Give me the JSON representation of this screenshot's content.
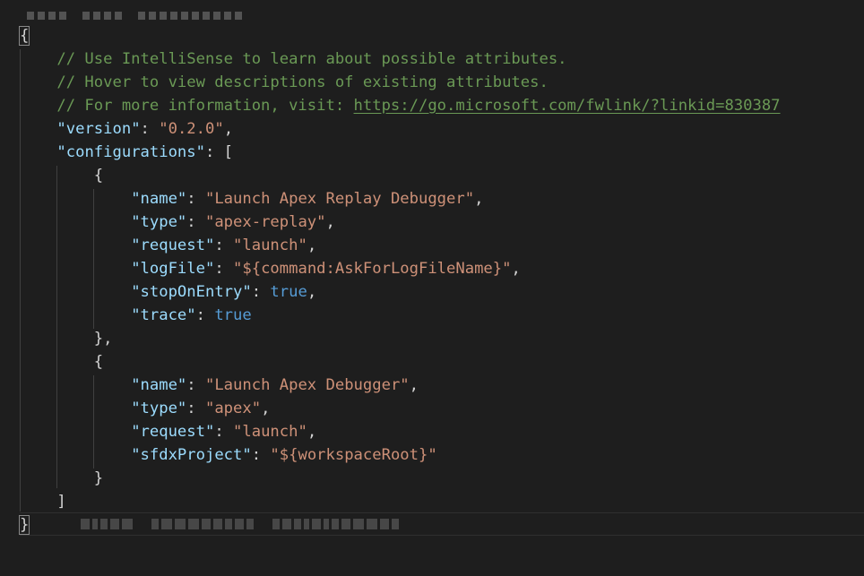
{
  "editor": {
    "lines": [
      [
        {
          "t": "{",
          "c": "punc bracket-hl"
        }
      ],
      [
        {
          "t": "    // Use IntelliSense to learn about possible attributes.",
          "c": "comment"
        }
      ],
      [
        {
          "t": "    // Hover to view descriptions of existing attributes.",
          "c": "comment"
        }
      ],
      [
        {
          "t": "    // For more information, visit: ",
          "c": "comment"
        },
        {
          "t": "https://go.microsoft.com/fwlink/?linkid=830387",
          "c": "link"
        }
      ],
      [
        {
          "t": "    ",
          "c": "punc"
        },
        {
          "t": "\"version\"",
          "c": "key"
        },
        {
          "t": ": ",
          "c": "punc"
        },
        {
          "t": "\"0.2.0\"",
          "c": "str"
        },
        {
          "t": ",",
          "c": "punc"
        }
      ],
      [
        {
          "t": "    ",
          "c": "punc"
        },
        {
          "t": "\"configurations\"",
          "c": "key"
        },
        {
          "t": ": [",
          "c": "punc"
        }
      ],
      [
        {
          "t": "        {",
          "c": "punc"
        }
      ],
      [
        {
          "t": "            ",
          "c": "punc"
        },
        {
          "t": "\"name\"",
          "c": "key"
        },
        {
          "t": ": ",
          "c": "punc"
        },
        {
          "t": "\"Launch Apex Replay Debugger\"",
          "c": "str"
        },
        {
          "t": ",",
          "c": "punc"
        }
      ],
      [
        {
          "t": "            ",
          "c": "punc"
        },
        {
          "t": "\"type\"",
          "c": "key"
        },
        {
          "t": ": ",
          "c": "punc"
        },
        {
          "t": "\"apex-replay\"",
          "c": "str"
        },
        {
          "t": ",",
          "c": "punc"
        }
      ],
      [
        {
          "t": "            ",
          "c": "punc"
        },
        {
          "t": "\"request\"",
          "c": "key"
        },
        {
          "t": ": ",
          "c": "punc"
        },
        {
          "t": "\"launch\"",
          "c": "str"
        },
        {
          "t": ",",
          "c": "punc"
        }
      ],
      [
        {
          "t": "            ",
          "c": "punc"
        },
        {
          "t": "\"logFile\"",
          "c": "key"
        },
        {
          "t": ": ",
          "c": "punc"
        },
        {
          "t": "\"${command:AskForLogFileName}\"",
          "c": "str"
        },
        {
          "t": ",",
          "c": "punc"
        }
      ],
      [
        {
          "t": "            ",
          "c": "punc"
        },
        {
          "t": "\"stopOnEntry\"",
          "c": "key"
        },
        {
          "t": ": ",
          "c": "punc"
        },
        {
          "t": "true",
          "c": "kw"
        },
        {
          "t": ",",
          "c": "punc"
        }
      ],
      [
        {
          "t": "            ",
          "c": "punc"
        },
        {
          "t": "\"trace\"",
          "c": "key"
        },
        {
          "t": ": ",
          "c": "punc"
        },
        {
          "t": "true",
          "c": "kw"
        }
      ],
      [
        {
          "t": "        },",
          "c": "punc"
        }
      ],
      [
        {
          "t": "        {",
          "c": "punc"
        }
      ],
      [
        {
          "t": "            ",
          "c": "punc"
        },
        {
          "t": "\"name\"",
          "c": "key"
        },
        {
          "t": ": ",
          "c": "punc"
        },
        {
          "t": "\"Launch Apex Debugger\"",
          "c": "str"
        },
        {
          "t": ",",
          "c": "punc"
        }
      ],
      [
        {
          "t": "            ",
          "c": "punc"
        },
        {
          "t": "\"type\"",
          "c": "key"
        },
        {
          "t": ": ",
          "c": "punc"
        },
        {
          "t": "\"apex\"",
          "c": "str"
        },
        {
          "t": ",",
          "c": "punc"
        }
      ],
      [
        {
          "t": "            ",
          "c": "punc"
        },
        {
          "t": "\"request\"",
          "c": "key"
        },
        {
          "t": ": ",
          "c": "punc"
        },
        {
          "t": "\"launch\"",
          "c": "str"
        },
        {
          "t": ",",
          "c": "punc"
        }
      ],
      [
        {
          "t": "            ",
          "c": "punc"
        },
        {
          "t": "\"sfdxProject\"",
          "c": "key"
        },
        {
          "t": ": ",
          "c": "punc"
        },
        {
          "t": "\"${workspaceRoot}\"",
          "c": "str"
        }
      ],
      [
        {
          "t": "        }",
          "c": "punc"
        }
      ],
      [
        {
          "t": "    ]",
          "c": "punc"
        }
      ],
      [
        {
          "t": "}",
          "c": "punc bracket-hl"
        }
      ]
    ]
  },
  "colors": {
    "background": "#1e1e1e",
    "comment": "#6a9955",
    "key": "#9cdcfe",
    "string": "#ce9178",
    "keyword": "#569cd6",
    "punctuation": "#d4d4d4"
  }
}
